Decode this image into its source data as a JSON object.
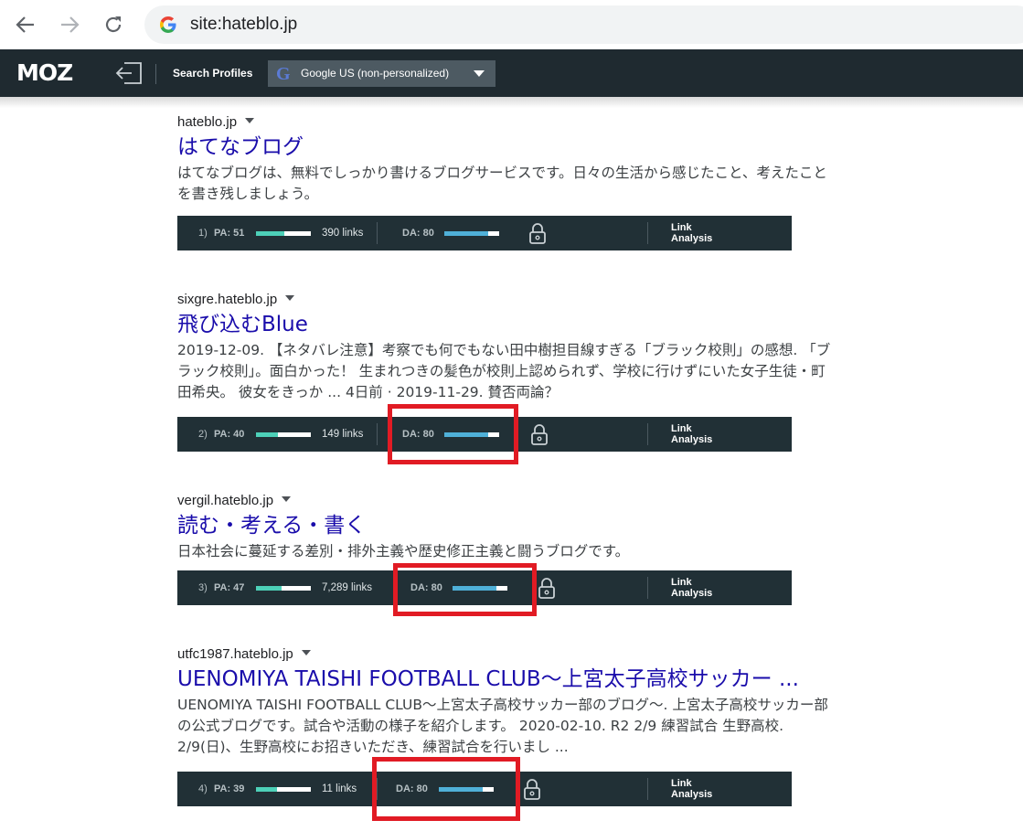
{
  "browser": {
    "address": "site:hateblo.jp"
  },
  "moz": {
    "logo": "MOZ",
    "search_profiles_label": "Search Profiles",
    "profile_icon": "G",
    "profile_value": "Google US (non-personalized)"
  },
  "results": [
    {
      "site": "hateblo.jp",
      "title": "はてなブログ",
      "snippet": "はてなブログは、無料でしっかり書けるブログサービスです。日々の生活から感じたこと、考えたことを書き残しましょう。",
      "mozbar": {
        "num": "1)",
        "pa": "PA: 51",
        "pa_value": 51,
        "links": "390 links",
        "da": "DA: 80",
        "da_value": 80,
        "link_analysis_1": "Link",
        "link_analysis_2": "Analysis"
      }
    },
    {
      "site": "sixgre.hateblo.jp",
      "title": "飛び込むBlue",
      "snippet": "2019-12-09. 【ネタバレ注意】考察でも何でもない田中樹担目線すぎる「ブラック校則」の感想. 「ブラック校則」。面白かった！ 生まれつきの髪色が校則上認められず、学校に行けずにいた女子生徒・町田希央。 彼女をきっか ... 4日前 · 2019-11-29. 賛否両論？",
      "mozbar": {
        "num": "2)",
        "pa": "PA: 40",
        "pa_value": 40,
        "links": "149 links",
        "da": "DA: 80",
        "da_value": 80,
        "link_analysis_1": "Link",
        "link_analysis_2": "Analysis"
      }
    },
    {
      "site": "vergil.hateblo.jp",
      "title": "読む・考える・書く",
      "snippet": "日本社会に蔓延する差別・排外主義や歴史修正主義と闘うブログです。",
      "mozbar": {
        "num": "3)",
        "pa": "PA: 47",
        "pa_value": 47,
        "links": "7,289 links",
        "da": "DA: 80",
        "da_value": 80,
        "link_analysis_1": "Link",
        "link_analysis_2": "Analysis"
      }
    },
    {
      "site": "utfc1987.hateblo.jp",
      "title": "UENOMIYA TAISHI FOOTBALL CLUB～上宮太子高校サッカー ...",
      "snippet": "UENOMIYA TAISHI FOOTBALL CLUB～上宮太子高校サッカー部のブログ～. 上宮太子高校サッカー部の公式ブログです。試合や活動の様子を紹介します。 2020-02-10. R2 2/9 練習試合 生野高校. 2/9(日)、生野高校にお招きいただき、練習試合を行いまし ...",
      "mozbar": {
        "num": "4)",
        "pa": "PA: 39",
        "pa_value": 39,
        "links": "11 links",
        "da": "DA: 80",
        "da_value": 80,
        "link_analysis_1": "Link",
        "link_analysis_2": "Analysis"
      }
    }
  ],
  "colors": {
    "highlight": "#e11b24",
    "link": "#1a0dab",
    "moz_bg": "#1f2a30"
  }
}
